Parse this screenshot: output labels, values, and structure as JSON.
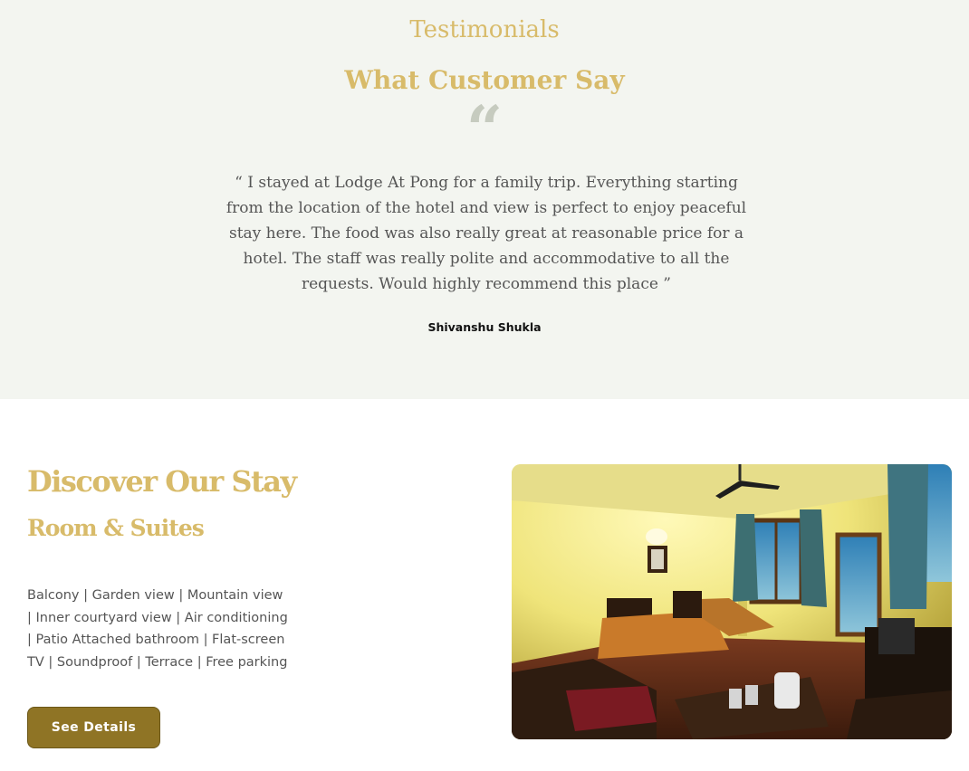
{
  "testimonials": {
    "eyebrow": "Testimonials",
    "title": "What Customer Say",
    "quote_mark": "“",
    "quote": "“ I stayed at Lodge At Pong for a family trip. Everything starting from the location of the hotel and view is perfect to enjoy peaceful stay here. The food was also really great at reasonable price for a hotel. The staff was really polite and accommodative to all the requests. Would highly recommend this place ”",
    "author": "Shivanshu Shukla"
  },
  "stay": {
    "title": "Discover Our Stay",
    "subtitle": "Room & Suites",
    "amenities": "Balcony | Garden view | Mountain view | Inner courtyard view | Air conditioning | Patio Attached bathroom | Flat-screen TV | Soundproof | Terrace | Free parking",
    "button_label": "See Details",
    "photo": "hotel-room-photo"
  },
  "colors": {
    "accent_gold": "#d8bb6a",
    "button_olive": "#8f7425",
    "testimonial_bg": "#f3f5f0"
  }
}
